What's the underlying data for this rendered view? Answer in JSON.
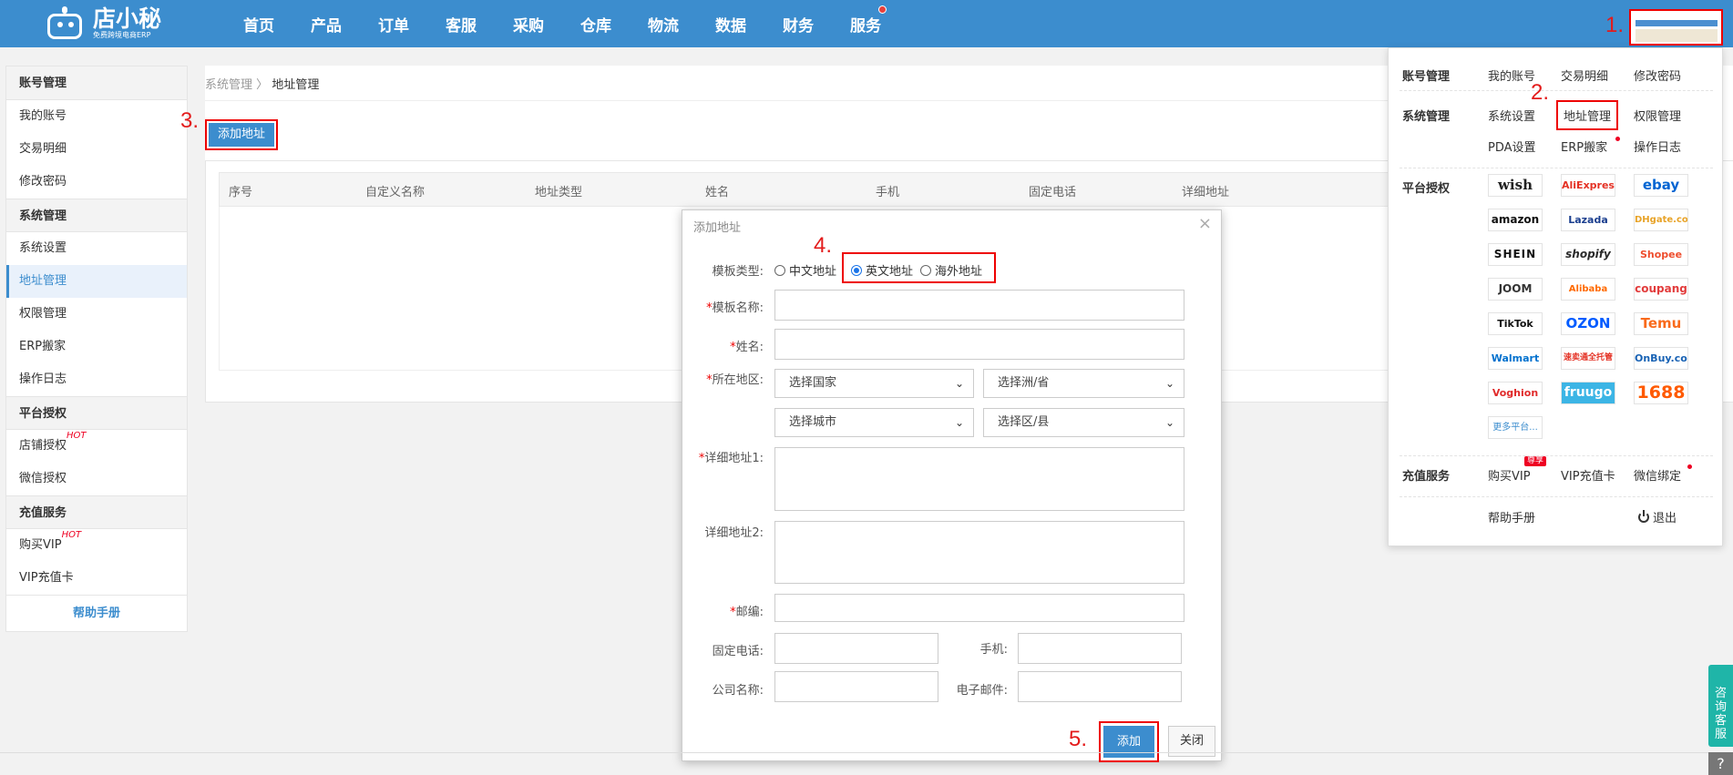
{
  "app": {
    "logo_name": "店小秘",
    "logo_sub": "免费跨境电商ERP",
    "nav": [
      "首页",
      "产品",
      "订单",
      "客服",
      "采购",
      "仓库",
      "物流",
      "数据",
      "财务",
      "服务"
    ]
  },
  "annotations": {
    "a1": "1.",
    "a2": "2.",
    "a3": "3.",
    "a4": "4.",
    "a5": "5."
  },
  "sidebar": {
    "sections": [
      {
        "title": "账号管理",
        "items": [
          {
            "label": "我的账号"
          },
          {
            "label": "交易明细"
          },
          {
            "label": "修改密码"
          }
        ]
      },
      {
        "title": "系统管理",
        "items": [
          {
            "label": "系统设置"
          },
          {
            "label": "地址管理",
            "active": true
          },
          {
            "label": "权限管理"
          },
          {
            "label": "ERP搬家"
          },
          {
            "label": "操作日志"
          }
        ]
      },
      {
        "title": "平台授权",
        "items": [
          {
            "label": "店铺授权",
            "hot": "HOT"
          },
          {
            "label": "微信授权"
          }
        ]
      },
      {
        "title": "充值服务",
        "items": [
          {
            "label": "购买VIP",
            "hot": "HOT"
          },
          {
            "label": "VIP充值卡"
          }
        ]
      }
    ],
    "help": "帮助手册"
  },
  "breadcrumb": {
    "parent": "系统管理",
    "sep": "〉",
    "current": "地址管理"
  },
  "add_button": "添加地址",
  "table": {
    "headers": [
      "序号",
      "自定义名称",
      "地址类型",
      "姓名",
      "手机",
      "固定电话",
      "详细地址"
    ]
  },
  "modal": {
    "title": "添加地址",
    "close": "×",
    "template_type_label": "模板类型:",
    "template_options": [
      {
        "label": "中文地址",
        "checked": false
      },
      {
        "label": "英文地址",
        "checked": true
      },
      {
        "label": "海外地址",
        "checked": false
      }
    ],
    "fields": {
      "template_name": "模板名称:",
      "name": "姓名:",
      "region": "所在地区:",
      "address1": "详细地址1:",
      "address2": "详细地址2:",
      "zip": "邮编:",
      "phone": "固定电话:",
      "mobile": "手机:",
      "company": "公司名称:",
      "email": "电子邮件:"
    },
    "selects": {
      "country": "选择国家",
      "state": "选择洲/省",
      "city": "选择城市",
      "district": "选择区/县"
    },
    "submit": "添加",
    "cancel": "关闭"
  },
  "dropdown": {
    "account": {
      "title": "账号管理",
      "links": [
        "我的账号",
        "交易明细",
        "修改密码"
      ]
    },
    "system": {
      "title": "系统管理",
      "links": [
        "系统设置",
        "地址管理",
        "权限管理",
        "PDA设置",
        "ERP搬家",
        "操作日志"
      ]
    },
    "platform": {
      "title": "平台授权",
      "platforms": [
        "wish",
        "AliExpress",
        "ebay",
        "amazon",
        "Lazada",
        "DHgate.com",
        "SHEIN",
        "shopify",
        "Shopee",
        "JOOM",
        "Alibaba",
        "coupang",
        "TikTok",
        "OZON",
        "Temu",
        "Walmart",
        "速卖通全托管",
        "OnBuy.com",
        "Voghion",
        "fruugo",
        "1688",
        "更多平台..."
      ]
    },
    "recharge": {
      "title": "充值服务",
      "links": [
        "购买VIP",
        "VIP充值卡",
        "微信绑定"
      ],
      "vip_tag": "尊享"
    },
    "footer": {
      "help": "帮助手册",
      "logout": "退出"
    }
  },
  "side_widget": {
    "consult": "咨询客服",
    "help": "?"
  }
}
